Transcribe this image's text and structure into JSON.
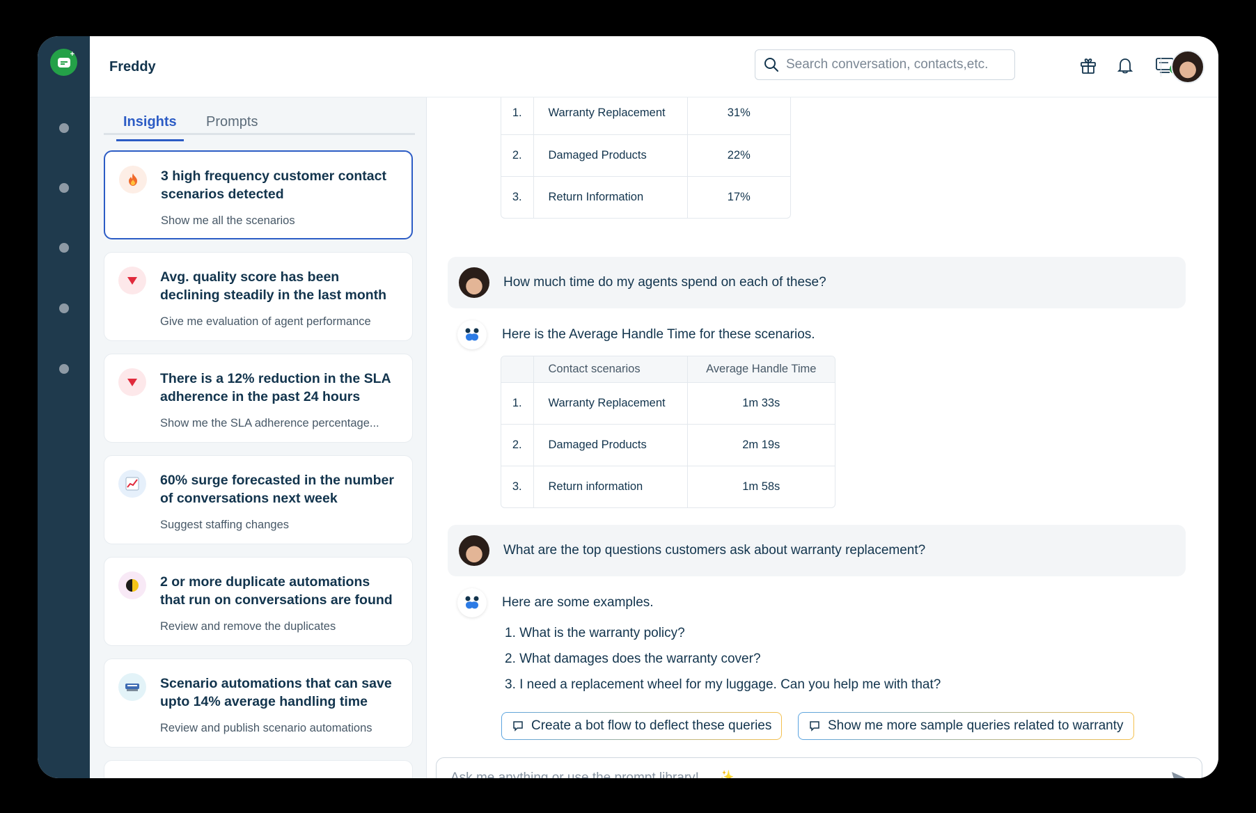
{
  "app": {
    "title": "Freddy"
  },
  "search": {
    "placeholder": "Search conversation, contacts,etc."
  },
  "tabs": [
    {
      "label": "Insights"
    },
    {
      "label": "Prompts"
    }
  ],
  "insights": [
    {
      "icon": "fire-icon",
      "title": "3 high frequency customer contact scenarios detected",
      "subtitle": "Show me all the scenarios"
    },
    {
      "icon": "down-triangle-icon",
      "title": "Avg. quality score has been declining steadily in the last month",
      "subtitle": "Give me evaluation of agent performance"
    },
    {
      "icon": "down-triangle-icon",
      "title": "There is a 12% reduction in the SLA adherence in the past 24 hours",
      "subtitle": "Show me the SLA adherence percentage..."
    },
    {
      "icon": "trend-chart-icon",
      "title": "60% surge forecasted in the number of conversations next week",
      "subtitle": "Suggest staffing changes"
    },
    {
      "icon": "half-circle-icon",
      "title": "2 or more duplicate automations that run on conversations are found",
      "subtitle": "Review and remove the duplicates"
    },
    {
      "icon": "automation-icon",
      "title": "Scenario automations that can save upto 14% average handling time",
      "subtitle": "Review and publish scenario automations"
    }
  ],
  "table1": {
    "rows": [
      {
        "num": "1.",
        "name": "Warranty Replacement",
        "value": "31%"
      },
      {
        "num": "2.",
        "name": "Damaged Products",
        "value": "22%"
      },
      {
        "num": "3.",
        "name": "Return Information",
        "value": "17%"
      }
    ]
  },
  "messages": {
    "user1": "How much time do my agents spend on each of these?",
    "bot1": "Here is the Average Handle Time for these scenarios.",
    "user2": "What are the top questions customers ask about warranty replacement?",
    "bot2": "Here are some examples."
  },
  "table2": {
    "headers": [
      "",
      "Contact scenarios",
      "Average Handle Time"
    ],
    "rows": [
      {
        "num": "1.",
        "name": "Warranty Replacement",
        "value": "1m 33s"
      },
      {
        "num": "2.",
        "name": "Damaged Products",
        "value": "2m 19s"
      },
      {
        "num": "3.",
        "name": "Return information",
        "value": "1m 58s"
      }
    ]
  },
  "examples": [
    "1. What is the warranty policy?",
    "2. What damages does the warranty cover?",
    "3. I need a replacement wheel for my luggage. Can you help me with that?"
  ],
  "suggestions": [
    "Create a bot flow to deflect these queries",
    "Show me more sample queries related to warranty"
  ],
  "composer": {
    "placeholder": "Ask me anything or use the prompt library!"
  },
  "colors": {
    "accent": "#2c5cc5",
    "sidebar": "#1f3a4d",
    "brand": "#24a148"
  }
}
